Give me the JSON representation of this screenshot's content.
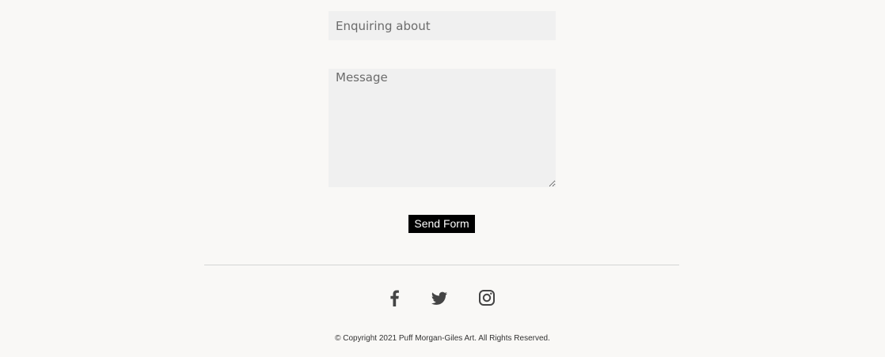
{
  "form": {
    "enquiry_placeholder": "Enquiring about",
    "message_placeholder": "Message",
    "send_label": "Send Form"
  },
  "social": {
    "facebook_icon": "facebook-icon",
    "twitter_icon": "twitter-icon",
    "instagram_icon": "instagram-icon",
    "icon_color": "#444444"
  },
  "footer": {
    "copyright": "© Copyright 2021 Puff Morgan-Giles Art. All Rights Reserved."
  },
  "colors": {
    "page_background": "#f9f8f6",
    "field_background": "#f0f0f0",
    "button_background": "#000000",
    "button_text": "#ffffff"
  }
}
